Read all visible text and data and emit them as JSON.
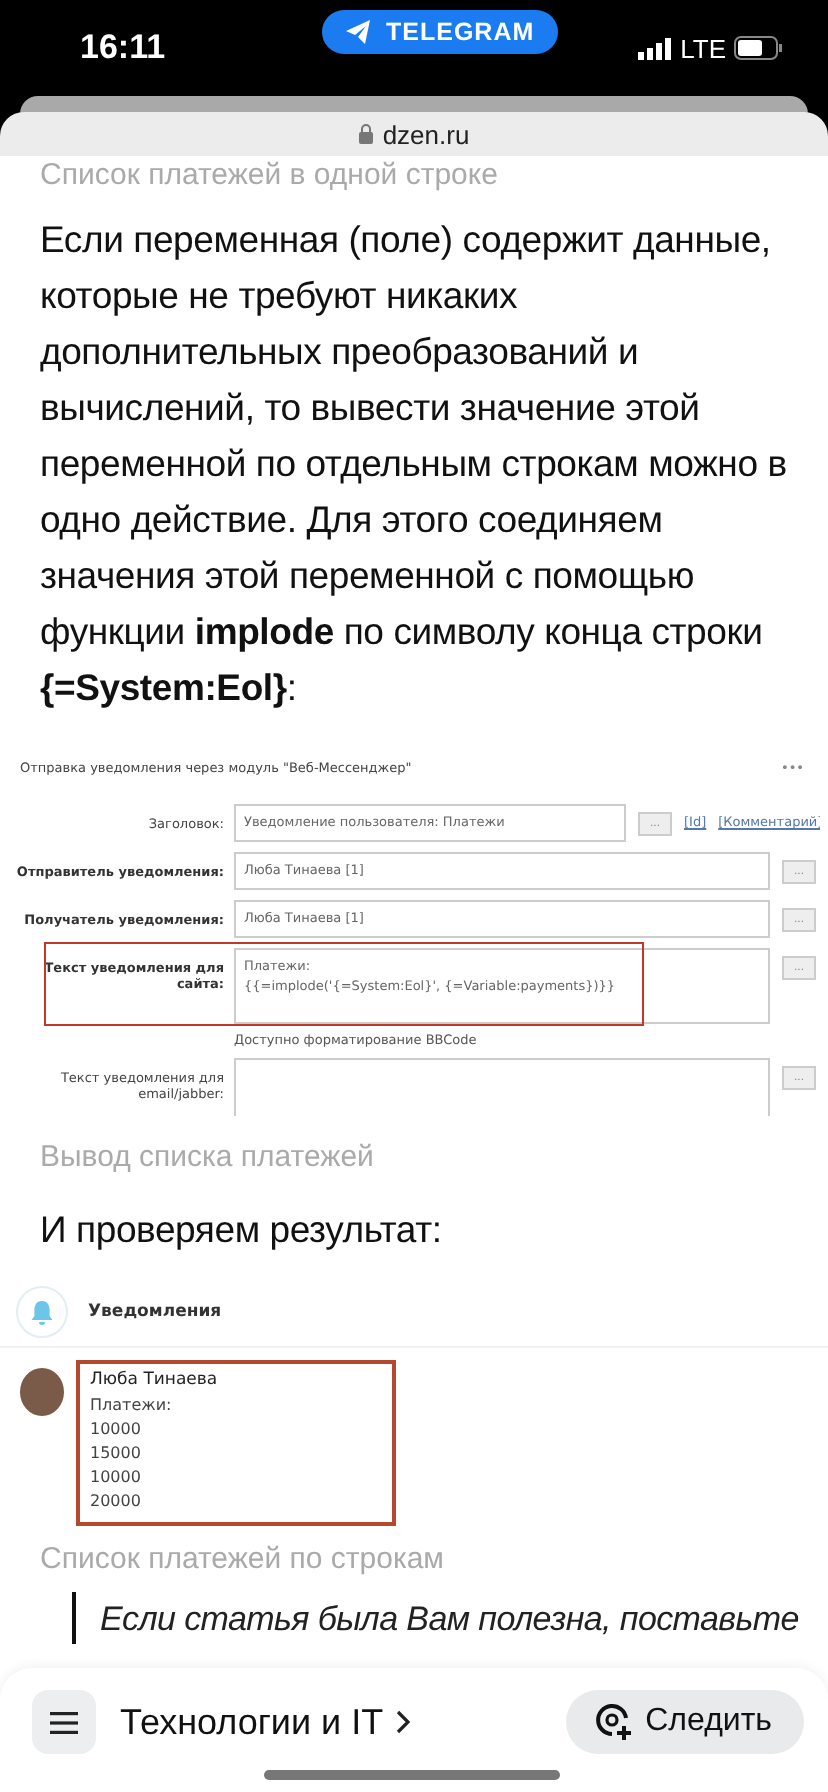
{
  "status_bar": {
    "time": "16:11",
    "back_app": "TELEGRAM",
    "network": "LTE"
  },
  "browser": {
    "url": "dzen.ru"
  },
  "article": {
    "caption_top": "Список платежей в одной строке",
    "paragraph": "Если переменная (поле) содержит данные, которые не требуют никаких дополнительных преобразований и вычислений, то вывести значение этой переменной по отдельным строкам можно в одно действие. Для этого соединяем значения этой переменной с помощью функции **implode** по символу конца строки **{=System:Eol}**:",
    "figure_form": {
      "title": "Отправка уведомления через модуль \"Веб-Мессенджер\"",
      "more": "•••",
      "rows": [
        {
          "label": "Заголовок:",
          "bold": false,
          "lines": [
            "Уведомление пользователя: Платежи"
          ],
          "button": "...",
          "links": [
            "[Id]",
            "[Комментарий]"
          ],
          "highlighted": false,
          "hint": ""
        },
        {
          "label": "Отправитель уведомления:",
          "bold": true,
          "lines": [
            "Люба Тинаева [1]"
          ],
          "button": "...",
          "links": [],
          "highlighted": false,
          "hint": ""
        },
        {
          "label": "Получатель уведомления:",
          "bold": true,
          "lines": [
            "Люба Тинаева [1]"
          ],
          "button": "...",
          "links": [],
          "highlighted": false,
          "hint": ""
        },
        {
          "label": "Текст уведомления для сайта:",
          "bold": true,
          "lines": [
            "Платежи:",
            "{{=implode('{=System:Eol}', {=Variable:payments})}}"
          ],
          "button": "...",
          "links": [],
          "highlighted": true,
          "hint": "Доступно форматирование BBCode"
        },
        {
          "label": "Текст уведомления для email/jabber:",
          "bold": false,
          "lines": [],
          "button": "...",
          "links": [],
          "highlighted": false,
          "hint": ""
        }
      ]
    },
    "caption_1": "Вывод списка платежей",
    "paragraph_2": "И проверяем результат:",
    "figure_result": {
      "header": "Уведомления",
      "author": "Люба Тинаева",
      "lines": [
        "Платежи:",
        "10000",
        "15000",
        "10000",
        "20000"
      ],
      "highlighted": true
    },
    "caption_2": "Список платежей по строкам",
    "quote": "Если статья была Вам полезна, поставьте"
  },
  "bottom_bar": {
    "channel": "Технологии и IT",
    "follow": "Следить"
  }
}
